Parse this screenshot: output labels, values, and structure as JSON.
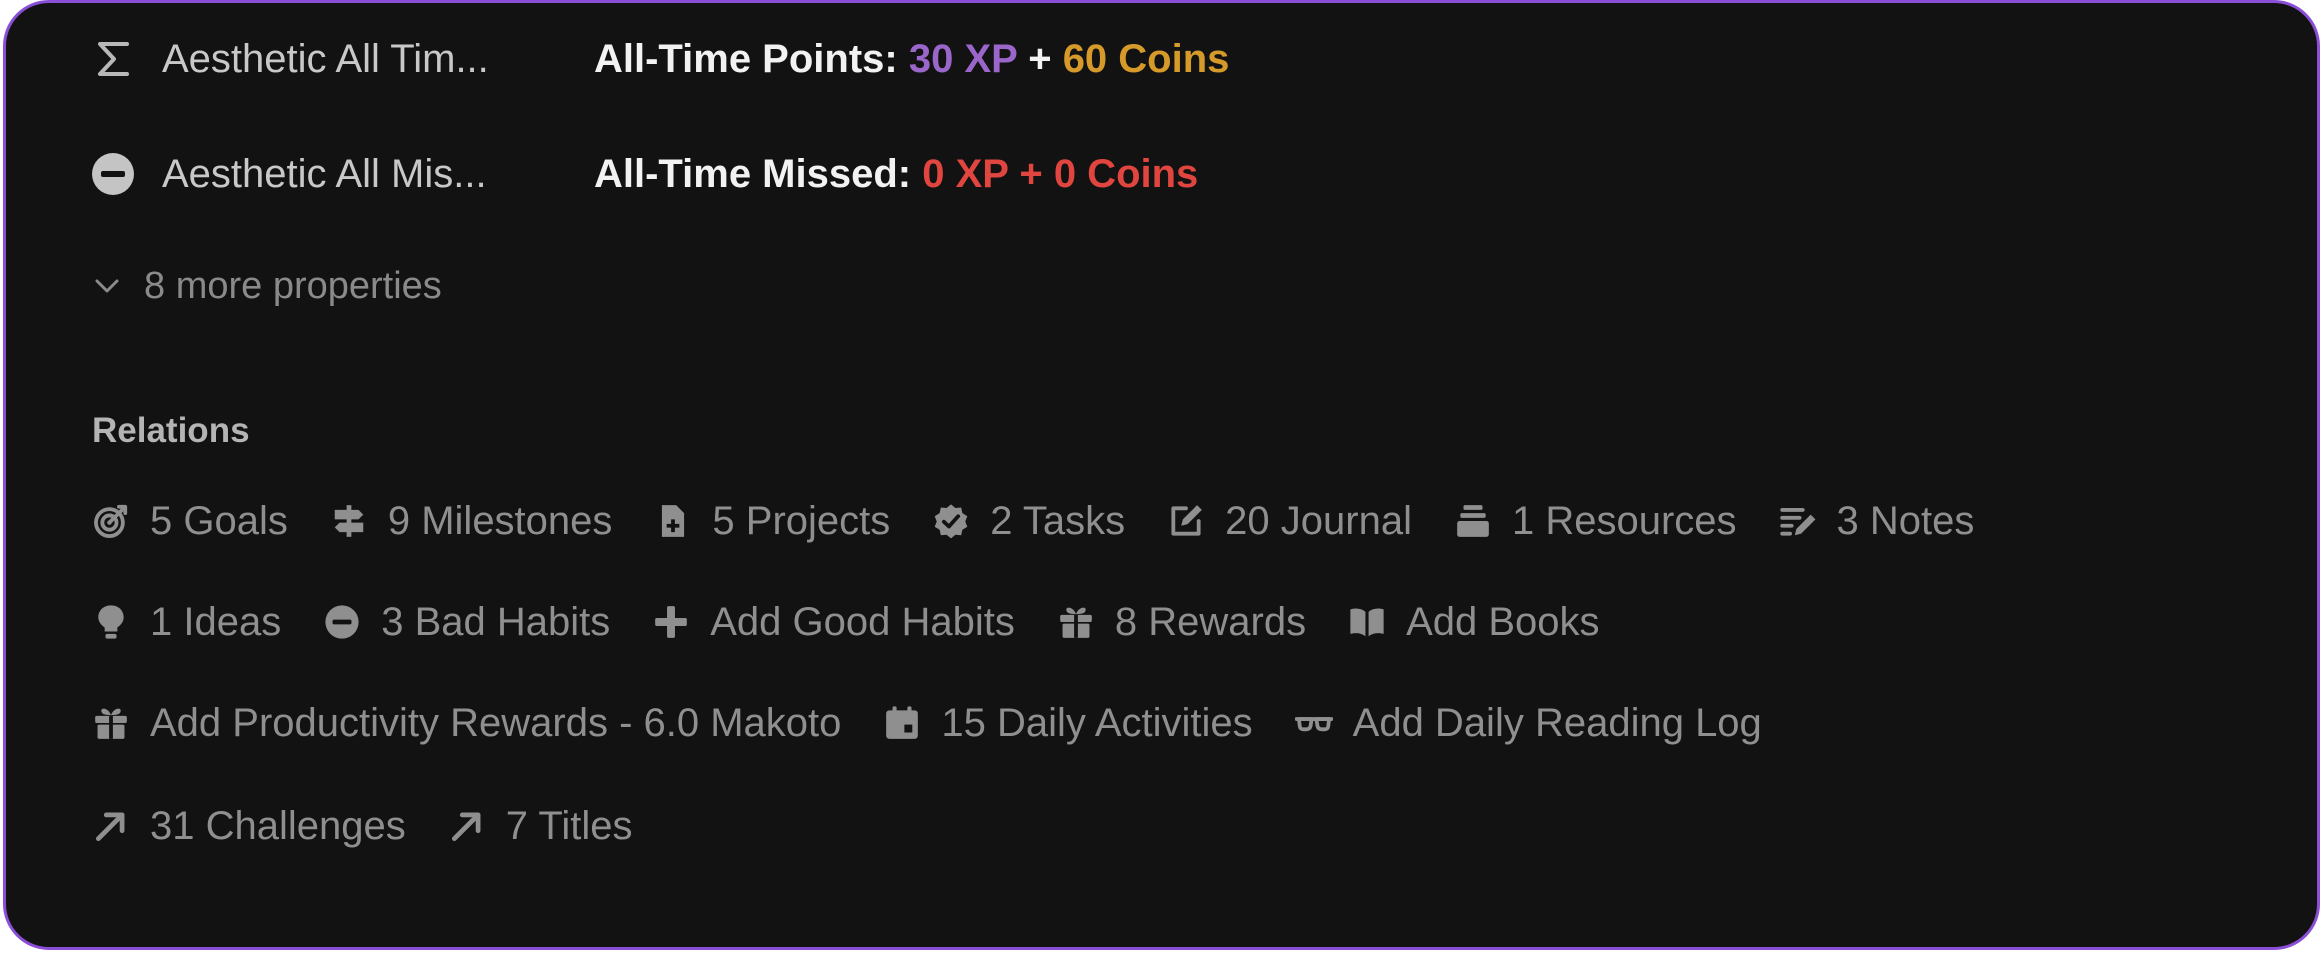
{
  "properties": [
    {
      "icon": "sigma-icon",
      "name": "Aesthetic All Tim...",
      "value_prefix": "All-Time Points: ",
      "xp": "30 XP",
      "joiner": " + ",
      "coins": "60 Coins"
    },
    {
      "icon": "minus-circle-icon",
      "name": "Aesthetic All Mis...",
      "value_prefix": "All-Time Missed: ",
      "missed": "0 XP + 0 Coins"
    }
  ],
  "more_properties": "8 more properties",
  "relations": {
    "heading": "Relations",
    "rows": [
      [
        {
          "icon": "target-icon",
          "label": "5 Goals"
        },
        {
          "icon": "signpost-icon",
          "label": "9 Milestones"
        },
        {
          "icon": "document-plus-icon",
          "label": "5 Projects"
        },
        {
          "icon": "verified-check-icon",
          "label": "2 Tasks"
        },
        {
          "icon": "edit-square-icon",
          "label": "20 Journal"
        },
        {
          "icon": "stack-icon",
          "label": "1 Resources"
        },
        {
          "icon": "notes-pencil-icon",
          "label": "3 Notes"
        }
      ],
      [
        {
          "icon": "lightbulb-icon",
          "label": "1 Ideas"
        },
        {
          "icon": "minus-circle-icon",
          "label": "3 Bad Habits"
        },
        {
          "icon": "plus-icon",
          "label": "Add Good Habits"
        },
        {
          "icon": "gift-icon",
          "label": "8 Rewards"
        },
        {
          "icon": "book-open-icon",
          "label": "Add Books"
        }
      ],
      [
        {
          "icon": "gift-icon",
          "label": "Add Productivity Rewards - 6.0 Makoto"
        },
        {
          "icon": "calendar-icon",
          "label": "15 Daily Activities"
        },
        {
          "icon": "glasses-icon",
          "label": "Add Daily Reading Log"
        }
      ],
      [
        {
          "icon": "arrow-up-right-icon",
          "label": "31 Challenges"
        },
        {
          "icon": "arrow-up-right-icon",
          "label": "7 Titles"
        }
      ]
    ]
  },
  "colors": {
    "background": "#121212",
    "border": "#8a4fd6",
    "xp": "#9b66c9",
    "coins": "#d69a2a",
    "missed": "#e0463f",
    "muted": "#8f8f8f"
  }
}
